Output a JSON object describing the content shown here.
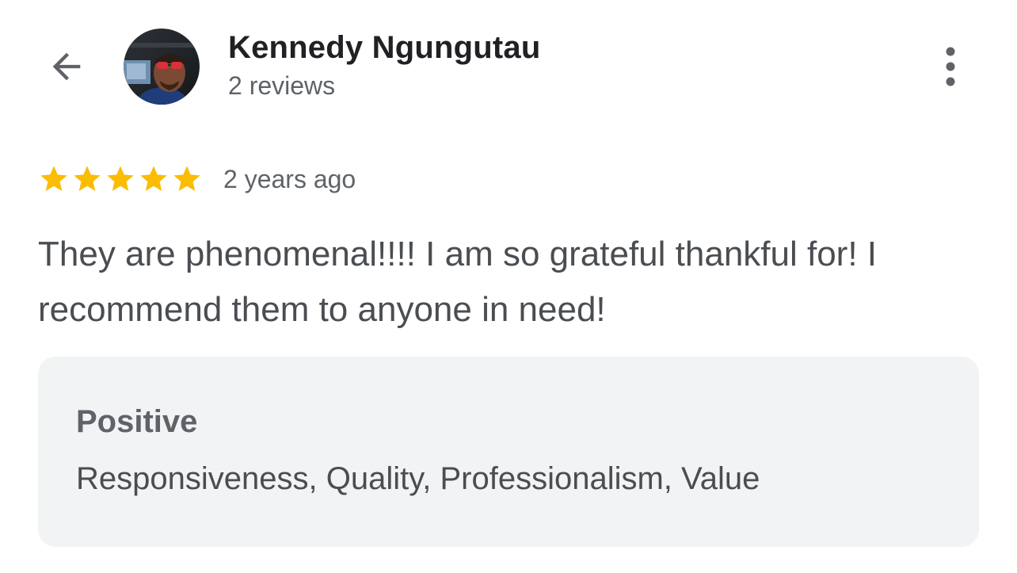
{
  "header": {
    "back_icon": "arrow-back-icon",
    "user_name": "Kennedy Ngungutau",
    "reviews_count_label": "2 reviews",
    "more_icon": "more-vert-icon"
  },
  "review": {
    "rating": 5,
    "rating_max": 5,
    "star_color": "#fbbc04",
    "time_ago": "2 years ago",
    "text": "They are phenomenal!!!! I am so grateful thankful for! I recommend them to anyone in need!"
  },
  "highlights": {
    "title": "Positive",
    "items": "Responsiveness, Quality, Professionalism, Value"
  },
  "colors": {
    "text_primary": "#202124",
    "text_secondary": "#5f6368",
    "panel_bg": "#f1f3f4",
    "accent_star": "#fbbc04"
  }
}
